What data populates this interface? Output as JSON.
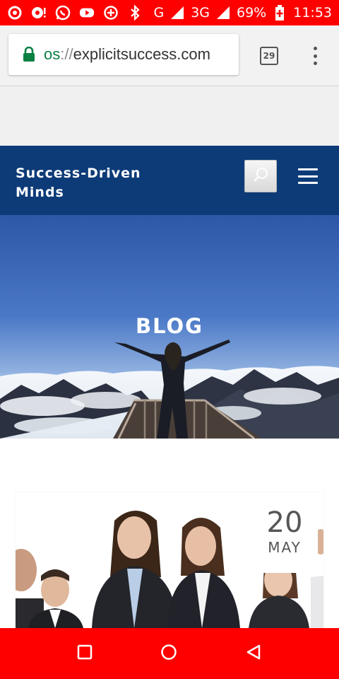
{
  "status_bar": {
    "left_icons": [
      "record-icon",
      "notification-icon",
      "whatsapp-icon",
      "youtube-icon",
      "data-saver-icon",
      "bluetooth-icon"
    ],
    "network_g": "G",
    "network_3g": "3G",
    "battery": "69%",
    "time": "11:53"
  },
  "browser": {
    "url_scheme": "os",
    "url_sep": "://",
    "url_host": "explicitsuccess.com",
    "tab_count": "29"
  },
  "site": {
    "title": "Success-Driven Minds"
  },
  "hero": {
    "title": "BLOG"
  },
  "post": {
    "day": "20",
    "month": "MAY"
  },
  "colors": {
    "status_bar": "#ff0000",
    "header": "#0d3b78",
    "url_secure": "#0b8043"
  }
}
